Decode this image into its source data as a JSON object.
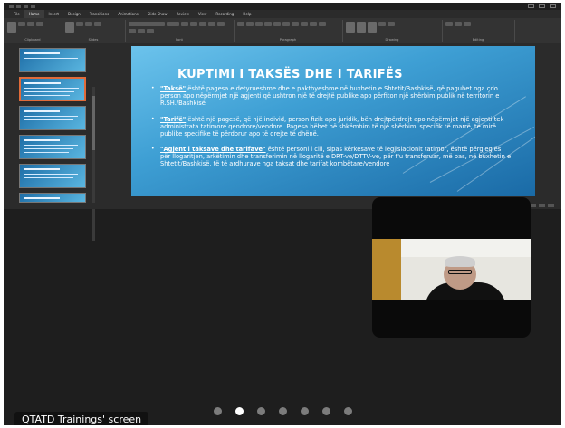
{
  "powerpoint": {
    "ribbon_tabs": [
      "File",
      "Home",
      "Insert",
      "Design",
      "Transitions",
      "Animations",
      "Slide Show",
      "Review",
      "View",
      "Recording",
      "Help"
    ],
    "ribbon_groups": [
      "Clipboard",
      "Slides",
      "Font",
      "Paragraph",
      "Drawing",
      "Editing"
    ],
    "slide": {
      "title": "KUPTIMI I TAKSËS DHE I TARIFËS",
      "bullets": [
        {
          "term": "\"Taksë\"",
          "text": " është pagesa e detyrueshme dhe e pakthyeshme në buxhetin e Shtetit/Bashkisë, që paguhet nga çdo person apo nëpërmjet një agjenti që ushtron një të drejtë publike apo përfiton një shërbim publik në territorin e R.SH./Bashkisë"
        },
        {
          "term": "\"Tarifë\"",
          "text": " është një pagesë, që një individ, person fizik apo juridik, bën drejtpërdrejt apo nëpërmjet një agjenti tek administrata tatimore qendrore/vendore. Pagesa bëhet në shkëmbim të një shërbimi specifik të marrë, të mirë publike specifike të përdorur apo të drejte të dhënë."
        },
        {
          "term": "\"Agjent i taksave dhe tarifave\"",
          "text": " është personi i cili, sipas kërkesave të legjislacionit tatimor, është përgjegjës për llogaritjen, arkëtimin dhe transferimin në llogaritë e DRT-ve/DTTV-ve, për t'u transferuar, më pas, në buxhetin e Shtetit/Bashkisë, të të ardhurave nga taksat dhe tarifat kombëtare/vendore"
        }
      ]
    }
  },
  "meeting": {
    "screen_label": "QTATD Trainings' screen",
    "pager_total": 7,
    "pager_active": 2
  }
}
